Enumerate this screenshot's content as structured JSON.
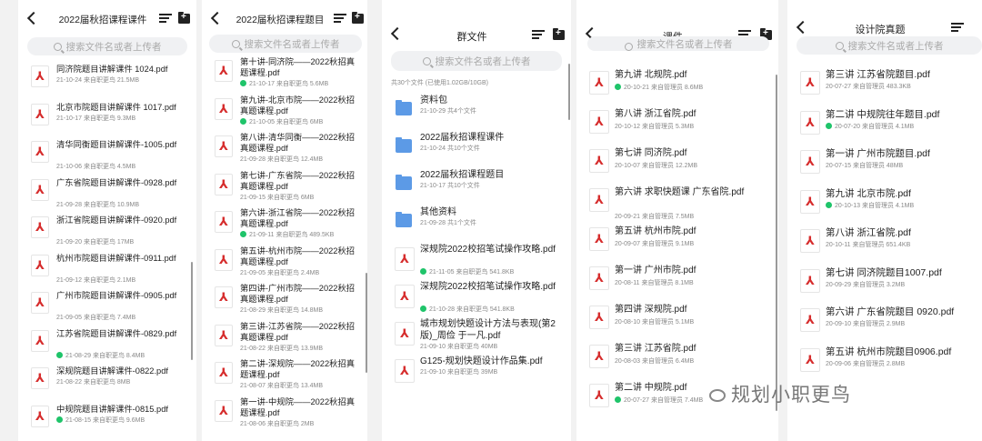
{
  "panel1": {
    "title": "2022届秋招课程课件",
    "search_placeholder": "搜索文件名或者上传者",
    "items": [
      {
        "name": "同济院题目讲解课件 1024.pdf",
        "meta": "21-10-24 来自职更鸟 21.5MB"
      },
      {
        "name": "北京市院题目讲解课件 1017.pdf",
        "meta": "21-10-17 来自职更鸟 9.3MB"
      },
      {
        "name": "清华同衡题目讲解课件-1005.pdf",
        "meta": "21-10-06 来自职更鸟 4.5MB"
      },
      {
        "name": "广东省院题目讲解课件-0928.pdf",
        "meta": "21-09-28 来自职更鸟 10.9MB"
      },
      {
        "name": "浙江省院题目讲解课件-0920.pdf",
        "meta": "21-09-20 来自职更鸟 17MB"
      },
      {
        "name": "杭州市院题目讲解课件-0911.pdf",
        "meta": "21-09-12 来自职更鸟 2.1MB"
      },
      {
        "name": "广州市院题目讲解课件-0905.pdf",
        "meta": "21-09-05 来自职更鸟 7.4MB"
      },
      {
        "name": "江苏省院题目讲解课件-0829.pdf",
        "meta": "21-08-29 来自职更鸟 8.4MB",
        "check": true
      },
      {
        "name": "深规院题目讲解课件-0822.pdf",
        "meta": "21-08-22 来自职更鸟 8MB"
      },
      {
        "name": "中规院题目讲解课件-0815.pdf",
        "meta": "21-08-15 来自职更鸟 9.6MB",
        "check": true
      }
    ]
  },
  "panel2": {
    "title": "2022届秋招课程题目",
    "search_placeholder": "搜索文件名或者上传者",
    "items": [
      {
        "name": "第十讲-同济院——2022秋招真题课程.pdf",
        "meta": "21-10-17 来自职更鸟 5.6MB",
        "check": true
      },
      {
        "name": "第九讲-北京市院——2022秋招真题课程.pdf",
        "meta": "21-10-05 来自职更鸟 6MB",
        "check": true
      },
      {
        "name": "第八讲-清华同衡——2022秋招真题课程.pdf",
        "meta": "21-09-28 来自职更鸟 12.4MB"
      },
      {
        "name": "第七讲-广东省院——2022秋招真题课程.pdf",
        "meta": "21-09-15 来自职更鸟 6MB"
      },
      {
        "name": "第六讲-浙江省院——2022秋招真题课程.pdf",
        "meta": "21-09-11 来自职更鸟 489.5KB",
        "check": true
      },
      {
        "name": "第五讲-杭州市院——2022秋招真题课程.pdf",
        "meta": "21-09-05 来自职更鸟 2.4MB"
      },
      {
        "name": "第四讲-广州市院——2022秋招真题课程.pdf",
        "meta": "21-08-29 来自职更鸟 14.8MB"
      },
      {
        "name": "第三讲-江苏省院——2022秋招真题课程.pdf",
        "meta": "21-08-22 来自职更鸟 13.9MB"
      },
      {
        "name": "第二讲-深规院——2022秋招真题课程.pdf",
        "meta": "21-08-07 来自职更鸟 13.4MB"
      },
      {
        "name": "第一讲-中规院——2022秋招真题课程.pdf",
        "meta": "21-08-06 来自职更鸟 2MB"
      }
    ]
  },
  "panel3": {
    "title": "群文件",
    "search_placeholder": "搜索文件名或者上传者",
    "summary": "共30个文件 (已使用1.02GB/10GB)",
    "items": [
      {
        "type": "folder",
        "name": "资料包",
        "meta": "21-10-29 共4个文件"
      },
      {
        "type": "folder",
        "name": "2022届秋招课程课件",
        "meta": "21-10-24 共10个文件"
      },
      {
        "type": "folder",
        "name": "2022届秋招课程题目",
        "meta": "21-10-17 共10个文件"
      },
      {
        "type": "folder",
        "name": "其他资料",
        "meta": "21-09-28 共1个文件"
      },
      {
        "type": "pdf",
        "name": "深规院2022校招笔试操作攻略.pdf",
        "meta": "21-11-05 来自职更鸟 541.8KB",
        "check": true
      },
      {
        "type": "pdf",
        "name": "深规院2022校招笔试操作攻略.pdf",
        "meta": "21-10-28 来自职更鸟 541.8KB",
        "check": true
      },
      {
        "type": "pdf",
        "name": "城市规划快题设计方法与表现(第2版)_周俭 于一凡.pdf",
        "meta": "21-09-10 来自职更鸟 40MB"
      },
      {
        "type": "pdf",
        "name": "G125-规划快题设计作品集.pdf",
        "meta": "21-09-10 来自职更鸟 39MB"
      }
    ]
  },
  "panel4": {
    "title": "课件",
    "search_placeholder": "搜索文件名或者上传者",
    "items": [
      {
        "name": "第九讲 北规院.pdf",
        "meta": "20-10-21 来自管理员 8.6MB",
        "check": true
      },
      {
        "name": "第八讲 浙江省院.pdf",
        "meta": "20-10-12 来自管理员 5.3MB"
      },
      {
        "name": "第七讲 同济院.pdf",
        "meta": "20-10-07 来自管理员 12.2MB"
      },
      {
        "name": "第六讲 求职快题课 广东省院.pdf",
        "meta": "20-09-21 来自管理员 7.5MB"
      },
      {
        "name": "第五讲 杭州市院.pdf",
        "meta": "20-09-07 来自管理员 9.1MB"
      },
      {
        "name": "第一讲 广州市院.pdf",
        "meta": "20-08-11 来自管理员 8.1MB"
      },
      {
        "name": "第四讲 深规院.pdf",
        "meta": "20-08-10 来自管理员 5.1MB"
      },
      {
        "name": "第三讲 江苏省院.pdf",
        "meta": "20-08-03 来自管理员 6.4MB"
      },
      {
        "name": "第二讲 中规院.pdf",
        "meta": "20-07-27 来自管理员 7.4MB",
        "check": true
      }
    ]
  },
  "panel5": {
    "title": "设计院真题",
    "search_placeholder": "搜索文件名或者上传者",
    "items": [
      {
        "name": "第三讲 江苏省院题目.pdf",
        "meta": "20-07-27 来自管理员 483.3KB"
      },
      {
        "name": "第二讲 中规院往年题目.pdf",
        "meta": "20-07-20 来自管理员 4.1MB",
        "check": true
      },
      {
        "name": "第一讲 广州市院题目.pdf",
        "meta": "20-07-15 来自管理员 48MB"
      },
      {
        "name": "第九讲 北京市院.pdf",
        "meta": "20-10-13 来自管理员 4.1MB",
        "check": true
      },
      {
        "name": "第八讲 浙江省院.pdf",
        "meta": "20-10-11 来自管理员 651.4KB"
      },
      {
        "name": "第七讲 同济院题目1007.pdf",
        "meta": "20-09-29 来自管理员 3.2MB"
      },
      {
        "name": "第六讲 广东省院题目 0920.pdf",
        "meta": "20-09-10 来自管理员 2.9MB"
      },
      {
        "name": "第五讲 杭州市院题目0906.pdf",
        "meta": "20-09-06 来自管理员 2.8MB"
      }
    ]
  },
  "watermark": "规划小职更鸟",
  "icons": {
    "file": "pdf-file-icon",
    "folder": "folder-icon",
    "back": "back-arrow-icon",
    "sort": "sort-icon",
    "new_folder": "new-folder-icon",
    "search": "search-icon"
  },
  "colors": {
    "pdf_red": "#d62d2d",
    "folder_blue": "#5c9ae6",
    "check_green": "#1fc46a"
  }
}
